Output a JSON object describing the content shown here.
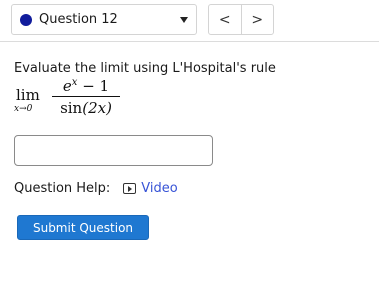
{
  "header": {
    "question_label": "Question 12",
    "status_color": "#111c9c",
    "prev_glyph": "<",
    "next_glyph": ">"
  },
  "question": {
    "prompt": "Evaluate the limit using L'Hospital's rule",
    "expression": {
      "lim_word": "lim",
      "approach": "x→0",
      "numerator_base": "e",
      "numerator_exponent": "x",
      "numerator_rest": " − 1",
      "denominator_func": "sin",
      "denominator_arg": "(2x)"
    }
  },
  "answer": {
    "value": "",
    "placeholder": ""
  },
  "help": {
    "label": "Question Help:",
    "icon": "video-icon",
    "link_text": "Video"
  },
  "submit": {
    "label": "Submit Question",
    "color": "#1f78d1"
  }
}
